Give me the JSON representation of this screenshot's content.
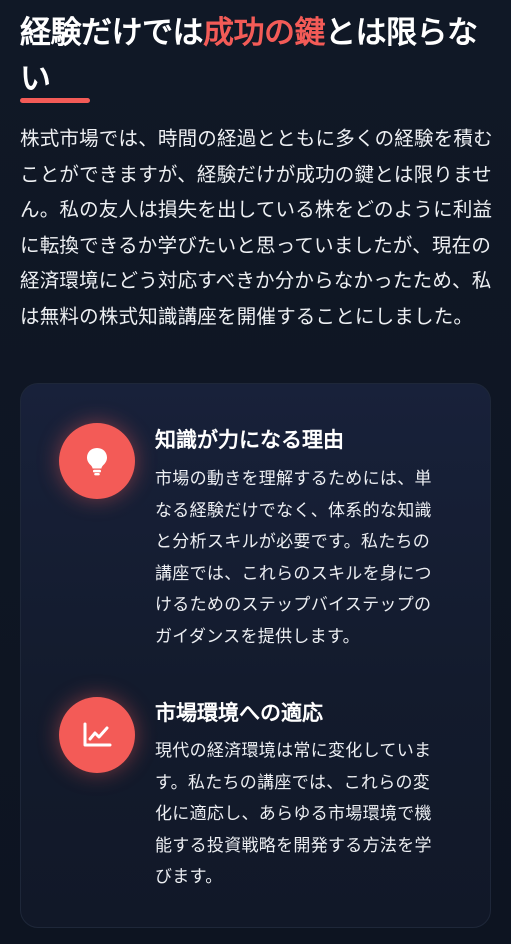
{
  "heading": {
    "part1": "経験だけでは",
    "accent": "成功の鍵",
    "part2": "とは限らない"
  },
  "intro": "株式市場では、時間の経過とともに多くの経験を積むことができますが、経験だけが成功の鍵とは限りません。私の友人は損失を出している株をどのように利益に転換できるか学びたいと思っていましたが、現在の経済環境にどう対応すべきか分からなかったため、私は無料の株式知識講座を開催することにしました。",
  "colors": {
    "accent": "#f35b57",
    "background": "#0f1623",
    "card": "#151d30"
  },
  "features": [
    {
      "icon": "lightbulb-icon",
      "title": "知識が力になる理由",
      "description": "市場の動きを理解するためには、単なる経験だけでなく、体系的な知識と分析スキルが必要です。私たちの講座では、これらのスキルを身につけるためのステップバイステップのガイダンスを提供します。"
    },
    {
      "icon": "line-chart-icon",
      "title": "市場環境への適応",
      "description": "現代の経済環境は常に変化しています。私たちの講座では、これらの変化に適応し、あらゆる市場環境で機能する投資戦略を開発する方法を学びます。"
    }
  ]
}
